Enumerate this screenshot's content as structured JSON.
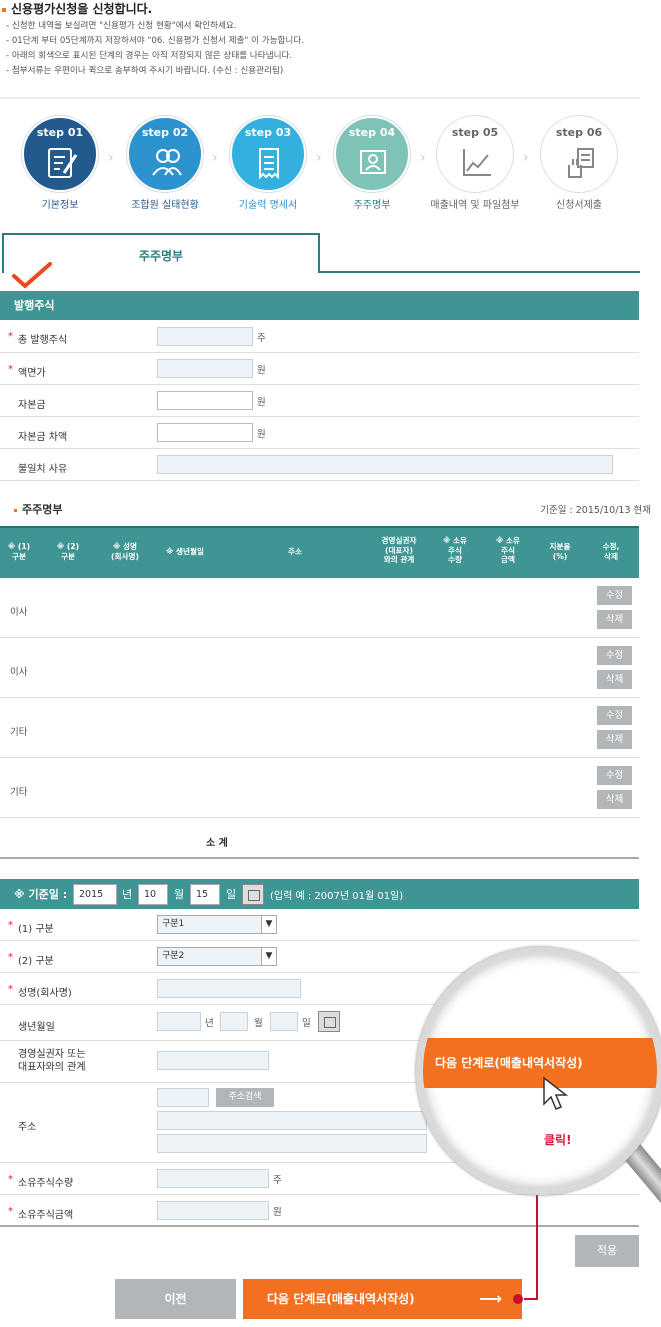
{
  "intro": {
    "title": "신용평가신청을 신청합니다.",
    "notes": [
      "- 신청한 내역을 보실려면 \"신용평가 신청 현황\"에서 확인하세요.",
      "- 01단계 부터 05단계까지 저장하셔야 \"06. 신용평가 신청서 제출\" 이 가능합니다.",
      "- 아래의 회색으로 표시된 단계의 경우는 아직 저장되지 않은 상태를 나타냅니다.",
      "- 첨부서류는 우편이나 퀵으로 송부하여 주시기 바랍니다. (수신 : 신용관리팀)"
    ]
  },
  "steps": [
    {
      "num": "step 01",
      "label": "기본정보",
      "color": "#235a8d"
    },
    {
      "num": "step 02",
      "label": "조합원 실태현황",
      "color": "#2d93cf"
    },
    {
      "num": "step 03",
      "label": "기술력 명세서",
      "color": "#33b0dd"
    },
    {
      "num": "step 04",
      "label": "주주명부",
      "color": "#7fc3b8"
    },
    {
      "num": "step 05",
      "label": "매출내역 및 파일첨부",
      "color": "#ffffff"
    },
    {
      "num": "step 06",
      "label": "신청서제출",
      "color": "#ffffff"
    }
  ],
  "tab": {
    "label": "주주명부"
  },
  "issued": {
    "title": "발행주식",
    "rows": [
      {
        "label": "총 발행주식",
        "unit": "주"
      },
      {
        "label": "액면가",
        "unit": "원"
      },
      {
        "label": "자본금",
        "unit": "원"
      },
      {
        "label": "자본금 차액",
        "unit": "원"
      },
      {
        "label": "불일치 사유",
        "unit": ""
      }
    ]
  },
  "list": {
    "title": "주주명부",
    "base_date": "기준일 : 2015/10/13 현재",
    "headers": [
      "※ (1)\n구분",
      "※ (2)\n구분",
      "※ 성명\n(회사명)",
      "※ 생년월일",
      "주소",
      "경영실권자\n(대표자)\n와의 관계",
      "※ 소유\n주식\n수량",
      "※ 소유\n주식\n금액",
      "지분율\n(%)",
      "수정,\n삭제"
    ],
    "rows": [
      {
        "type": "이사"
      },
      {
        "type": "이사"
      },
      {
        "type": "기타"
      },
      {
        "type": "기타"
      }
    ],
    "edit_label": "수정",
    "delete_label": "삭제",
    "subtotal": "소 계"
  },
  "dateform": {
    "label": "※ 기준일 :",
    "year": "2015",
    "year_unit": "년",
    "month": "10",
    "month_unit": "월",
    "day": "15",
    "day_unit": "일",
    "example": "(입력 예 : 2007년 01월 01일)"
  },
  "detail": {
    "type1_label": "(1) 구분",
    "type1_value": "구분1",
    "type2_label": "(2) 구분",
    "type2_value": "구분2",
    "name_label": "성명(회사명)",
    "birth_label": "생년월일",
    "birth_y": "년",
    "birth_m": "월",
    "birth_d": "일",
    "relation_label": "경영실권자 또는\n대표자와의 관계",
    "address_label": "주소",
    "address_search": "주소검색",
    "qty_label": "소유주식수량",
    "qty_unit": "주",
    "amt_label": "소유주식금액",
    "amt_unit": "원"
  },
  "buttons": {
    "apply": "적용",
    "prev": "이전",
    "next": "다음 단계로(매출내역서작성)",
    "next_arrow": "⟶"
  },
  "magnifier": {
    "button": "다음 단계로(매출내역서작성)",
    "click": "클릭!"
  }
}
